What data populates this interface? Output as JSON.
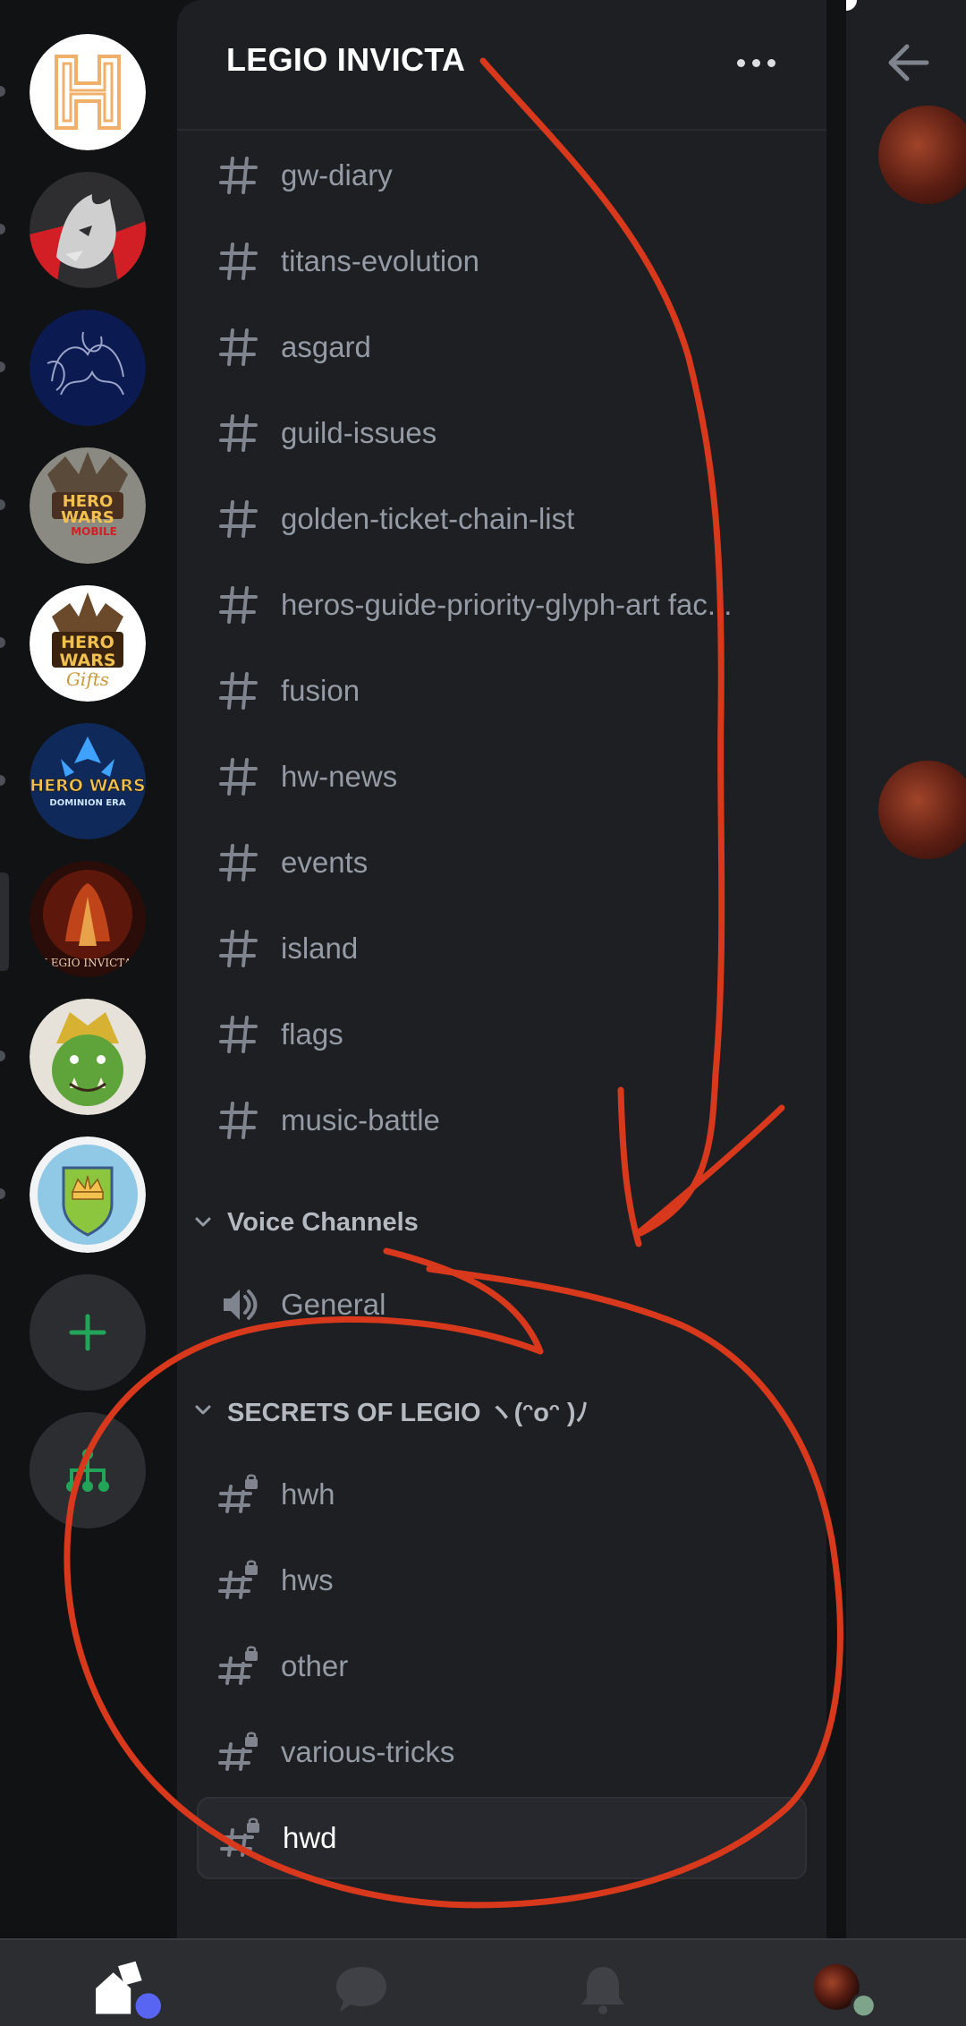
{
  "guild": {
    "name": "LEGIO INVICTA"
  },
  "header": {
    "more_icon": "more-dots-icon"
  },
  "text_channels": [
    {
      "name": "gw-diary"
    },
    {
      "name": "titans-evolution"
    },
    {
      "name": "asgard"
    },
    {
      "name": "guild-issues"
    },
    {
      "name": "golden-ticket-chain-list"
    },
    {
      "name": "heros-guide-priority-glyph-art fac..."
    },
    {
      "name": "fusion"
    },
    {
      "name": "hw-news"
    },
    {
      "name": "events"
    },
    {
      "name": "island"
    },
    {
      "name": "flags"
    },
    {
      "name": "music-battle"
    }
  ],
  "voice_category": {
    "label": "Voice Channels"
  },
  "voice_channels": [
    {
      "name": "General"
    }
  ],
  "secret_category": {
    "label": "SECRETS OF LEGIO ヽ(ᵔoᵔ )ﾉ"
  },
  "secret_channels": [
    {
      "name": "hwh"
    },
    {
      "name": "hws"
    },
    {
      "name": "other"
    },
    {
      "name": "various-tricks"
    },
    {
      "name": "hwd",
      "selected": true
    }
  ],
  "servers": [
    {
      "name": "H",
      "icon": "h-logo-server-icon"
    },
    {
      "name": "wolf",
      "icon": "wolf-server-icon"
    },
    {
      "name": "octopus",
      "icon": "octopus-server-icon"
    },
    {
      "name": "HERO WARS MOBILE",
      "icon": "hero-wars-mobile-server-icon"
    },
    {
      "name": "HERO WARS Gifts",
      "icon": "hero-wars-gifts-server-icon"
    },
    {
      "name": "HERO WARS DOMINION ERA",
      "icon": "hero-wars-dominion-server-icon"
    },
    {
      "name": "LEGIO INVICTA",
      "icon": "legio-invicta-server-icon"
    },
    {
      "name": "orc",
      "icon": "orc-server-icon"
    },
    {
      "name": "crown shield",
      "icon": "crown-shield-server-icon"
    }
  ],
  "colors": {
    "accent_green": "#23a559",
    "annotation_red": "#d8391c",
    "blurple": "#5865f2",
    "online_green": "#7ea58b"
  }
}
